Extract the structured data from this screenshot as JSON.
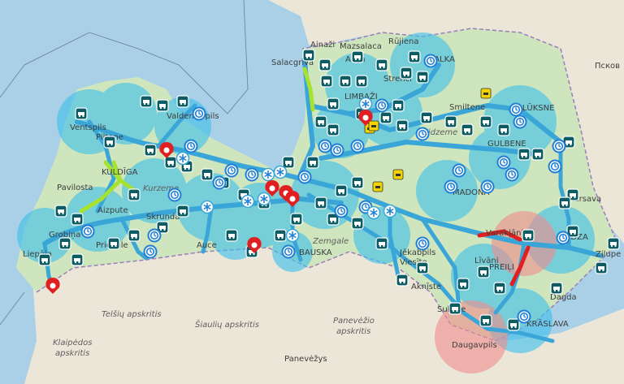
{
  "map": {
    "colors": {
      "sea": "#a9d0e6",
      "latvia_land": "#cfe5bd",
      "neighbor_land": "#ece6d9",
      "road_network": "#3aa6d8",
      "coverage_blue": "#3fc0ea",
      "coverage_red": "#f08c8c",
      "marker_teal": "#0d5c63",
      "marker_blue": "#1f7fd6",
      "alert_red": "#e02020",
      "highlight_green": "#a6e22e",
      "warning_yellow": "#f2d300"
    },
    "place_labels": {
      "ainazi": "Ainaži",
      "mazsalaca": "Mazsalaca",
      "rujiena": "Rūjiena",
      "salacgriva": "Salacgrīva",
      "aloja": "Aloja",
      "valka": "VALKA",
      "limbazi": "LIMBAŽI",
      "strenci": "Strenči",
      "aluksne": "ALŪKSNE",
      "smiltene": "Smiltene",
      "gulbene": "GULBENE",
      "pskov": "Псков",
      "ventspils": "Ventspils",
      "piltene": "Piltene",
      "talsi": "Valdemārpils",
      "kuldiga": "KULDĪGA",
      "kurzeme": "Kurzeme",
      "vidzeme": "Vidzeme",
      "pavilosta": "Pavilosta",
      "aizpute": "Aizpute",
      "skrunda": "Skrunda",
      "liepaja": "Liepāja",
      "grobina": "Grobiņa",
      "priekule": "Priekule",
      "auce": "Auce",
      "bauska": "BAUSKA",
      "zemgale": "Zemgale",
      "jekabpils": "Jēkabpils",
      "viesite": "Viesīte",
      "livani": "Līvāni",
      "varaklani": "Varakļāni",
      "preili": "PREIĻI",
      "madona": "MADONA",
      "karsava": "Kārsava",
      "ludza": "LUDZA",
      "zilupe": "Zilupe",
      "dagda": "Dagda",
      "kraslava": "KRĀSLAVA",
      "daugavpils": "Daugavpils",
      "subate": "Subate",
      "akniste": "Aknīste",
      "telsiai": "Telšių apskritis",
      "siauliai": "Šiaulių apskritis",
      "panevezio": "Panevėžio",
      "panevezio2": "apskritis",
      "klaipedos": "Klaipėdos",
      "klaipedos2": "apskritis",
      "panevezys": "Panevėžys"
    },
    "markers": {
      "teal_icon": "truck-camera-icon",
      "blue_icon": "clock-sensor-icon",
      "red_icon": "accident-warning-icon",
      "snow_icon": "snowflake-icon",
      "yellow_icon": "roadworks-icon"
    }
  }
}
